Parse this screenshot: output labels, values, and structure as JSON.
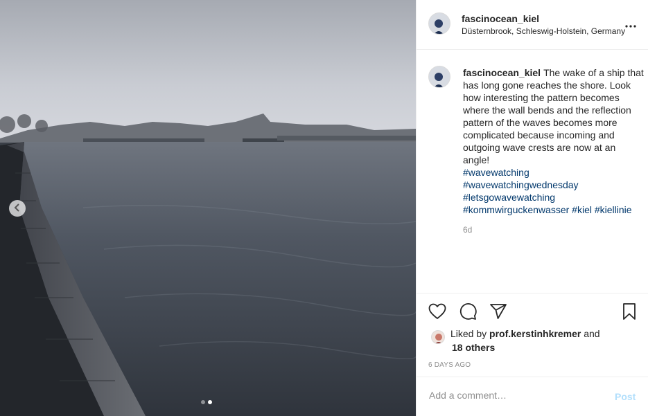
{
  "post": {
    "username": "fascinocean_kiel",
    "location": "Düsternbrook, Schleswig-Holstein, Germany",
    "caption_text": "The wake of a ship that has long gone reaches the shore. Look how interesting the pattern becomes where the wall bends and the reflection pattern of the waves becomes more complicated because incoming and outgoing wave crests are now at an angle!",
    "hashtags": [
      "#wavewatching",
      "#wavewatchingwednesday",
      "#letsgowavewatching",
      "#kommwirguckenwasser",
      "#kiel",
      "#kiellinie"
    ],
    "relative_time": "6d",
    "liked_by_prefix": "Liked by",
    "liked_by_user": "prof.kerstinhkremer",
    "liked_by_and": "and",
    "liked_by_others": "18 others",
    "date": "6 DAYS AGO"
  },
  "comment": {
    "placeholder": "Add a comment…",
    "post_label": "Post"
  },
  "carousel": {
    "slide_count": 2,
    "active_slide": 2
  },
  "icons": {
    "more": "more-options-icon",
    "like": "heart-icon",
    "comment": "comment-icon",
    "share": "share-icon",
    "save": "bookmark-icon",
    "prev": "chevron-left-icon"
  },
  "colors": {
    "hashtag": "#00376b",
    "post_button": "#b2dffc",
    "muted_text": "#8e8e8e"
  }
}
